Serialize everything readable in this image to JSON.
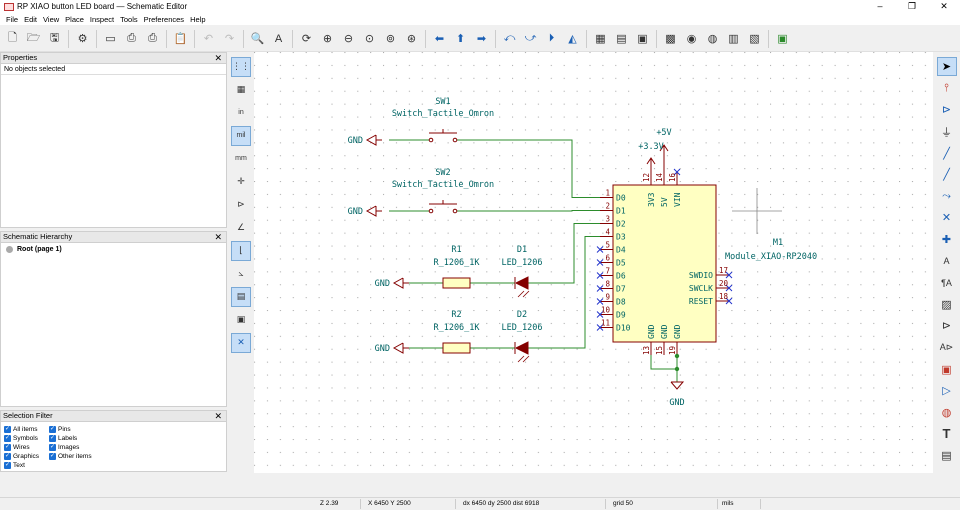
{
  "window": {
    "title": "RP XIAO button LED board — Schematic Editor",
    "controls": [
      "–",
      "❐",
      "✕"
    ]
  },
  "menu": [
    "File",
    "Edit",
    "View",
    "Place",
    "Inspect",
    "Tools",
    "Preferences",
    "Help"
  ],
  "panels": {
    "properties": {
      "title": "Properties",
      "empty_text": "No objects selected"
    },
    "hierarchy": {
      "title": "Schematic Hierarchy",
      "root": "Root (page 1)"
    },
    "selection_filter": {
      "title": "Selection Filter",
      "items": [
        "All items",
        "Pins",
        "Symbols",
        "Labels",
        "Wires",
        "Images",
        "Graphics",
        "Other items",
        "Text"
      ]
    }
  },
  "left_toolbar": {
    "units": [
      "in",
      "mil",
      "mm"
    ]
  },
  "schematic": {
    "colors": {
      "wire": "#2c8c2c",
      "body": "#840000",
      "body_fill": "#ffffc2",
      "pin_text": "#006464",
      "power": "#840000"
    },
    "sw1": {
      "ref": "SW1",
      "value": "Switch_Tactile_Omron"
    },
    "sw2": {
      "ref": "SW2",
      "value": "Switch_Tactile_Omron"
    },
    "r1": {
      "ref": "R1",
      "value": "R_1206_1K"
    },
    "r2": {
      "ref": "R2",
      "value": "R_1206_1K"
    },
    "d1": {
      "ref": "D1",
      "value": "LED_1206"
    },
    "d2": {
      "ref": "D2",
      "value": "LED_1206"
    },
    "m1": {
      "ref": "M1",
      "value": "Module_XIAO-RP2040"
    },
    "gnd": "GND",
    "p5v": "+5V",
    "p3v3": "+3.3V",
    "left_pins": [
      {
        "num": "1",
        "name": "D0"
      },
      {
        "num": "2",
        "name": "D1"
      },
      {
        "num": "3",
        "name": "D2"
      },
      {
        "num": "4",
        "name": "D3"
      },
      {
        "num": "5",
        "name": "D4"
      },
      {
        "num": "6",
        "name": "D5"
      },
      {
        "num": "7",
        "name": "D6"
      },
      {
        "num": "8",
        "name": "D7"
      },
      {
        "num": "9",
        "name": "D8"
      },
      {
        "num": "10",
        "name": "D9"
      },
      {
        "num": "11",
        "name": "D10"
      }
    ],
    "right_pins": [
      {
        "num": "17",
        "name": "SWDIO"
      },
      {
        "num": "20",
        "name": "SWCLK"
      },
      {
        "num": "18",
        "name": "RESET"
      }
    ],
    "top_pins": [
      {
        "num": "12",
        "name": "3V3"
      },
      {
        "num": "14",
        "name": "5V"
      },
      {
        "num": "16",
        "name": "VIN"
      }
    ],
    "bottom_pins": [
      {
        "num": "13",
        "name": "GND"
      },
      {
        "num": "15",
        "name": "GND"
      },
      {
        "num": "19",
        "name": "GND"
      }
    ]
  },
  "status": {
    "zoom": "Z 2.39",
    "xy": "X 6450  Y 2500",
    "delta": "dx 6450  dy 2500  dist 6918",
    "grid": "grid 50",
    "units": "mils"
  }
}
